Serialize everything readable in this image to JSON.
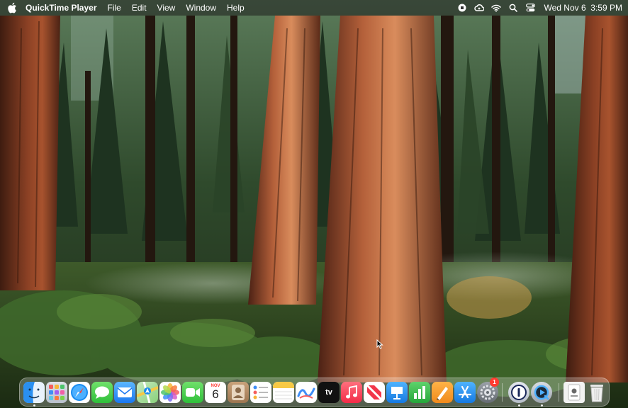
{
  "menubar": {
    "apple_icon": "apple-logo-icon",
    "app_name": "QuickTime Player",
    "menus": [
      "File",
      "Edit",
      "View",
      "Window",
      "Help"
    ],
    "status_icons": [
      "screen-record-stop-icon",
      "creative-cloud-icon",
      "wifi-icon",
      "spotlight-search-icon",
      "control-center-icon"
    ],
    "clock": {
      "date": "Wed Nov 6",
      "time": "3:59 PM"
    }
  },
  "desktop": {
    "wallpaper": "sequoia-forest-wallpaper"
  },
  "dock": {
    "apps": [
      {
        "name": "Finder",
        "icon": "finder-icon",
        "running": true
      },
      {
        "name": "Launchpad",
        "icon": "launchpad-icon"
      },
      {
        "name": "Safari",
        "icon": "safari-icon"
      },
      {
        "name": "Messages",
        "icon": "messages-icon"
      },
      {
        "name": "Mail",
        "icon": "mail-icon"
      },
      {
        "name": "Maps",
        "icon": "maps-icon"
      },
      {
        "name": "Photos",
        "icon": "photos-icon"
      },
      {
        "name": "FaceTime",
        "icon": "facetime-icon"
      },
      {
        "name": "Calendar",
        "icon": "calendar-icon",
        "month": "NOV",
        "day": "6"
      },
      {
        "name": "Contacts",
        "icon": "contacts-icon"
      },
      {
        "name": "Reminders",
        "icon": "reminders-icon"
      },
      {
        "name": "Notes",
        "icon": "notes-icon"
      },
      {
        "name": "Freeform",
        "icon": "freeform-icon"
      },
      {
        "name": "TV",
        "icon": "apple-tv-icon",
        "label": "tv"
      },
      {
        "name": "Music",
        "icon": "music-icon"
      },
      {
        "name": "News",
        "icon": "news-icon"
      },
      {
        "name": "Keynote",
        "icon": "keynote-icon"
      },
      {
        "name": "Numbers",
        "icon": "numbers-icon"
      },
      {
        "name": "Pages",
        "icon": "pages-icon"
      },
      {
        "name": "App Store",
        "icon": "app-store-icon"
      },
      {
        "name": "System Settings",
        "icon": "system-settings-icon",
        "badge": "1"
      },
      {
        "name": "1Password",
        "icon": "1password-icon",
        "running": true
      },
      {
        "name": "QuickTime Player",
        "icon": "quicktime-icon",
        "running": true
      }
    ],
    "right_items": [
      {
        "name": "Downloads",
        "icon": "downloads-stack-icon"
      },
      {
        "name": "Trash",
        "icon": "trash-icon"
      }
    ]
  },
  "colors": {
    "menubar_bg": "#1e1e1e",
    "dock_bg": "#ffffff",
    "badge": "#ff3b30"
  }
}
